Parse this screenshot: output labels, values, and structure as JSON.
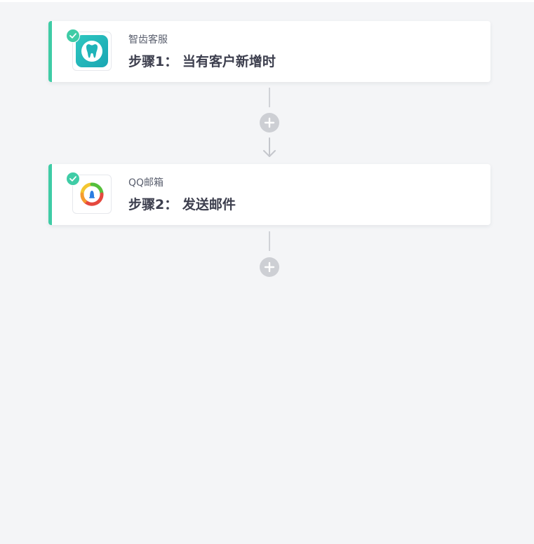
{
  "steps": [
    {
      "app_name": "智齿客服",
      "title": "步骤1： 当有客户新增时",
      "icon": "tooth-app-icon",
      "status": "completed"
    },
    {
      "app_name": "QQ邮箱",
      "title": "步骤2： 发送邮件",
      "icon": "qq-mail-app-icon",
      "status": "completed"
    }
  ],
  "icons": {
    "add_step": "plus-icon",
    "flow_arrow": "arrow-down-icon",
    "status_check": "check-icon"
  },
  "colors": {
    "background": "#f4f5f7",
    "accent": "#3fcca6",
    "card": "#ffffff",
    "connector": "#d0d2d7",
    "add_button": "#cdcfd4",
    "title_text": "#3d3f4e",
    "app_name_text": "#5a5f6e"
  }
}
